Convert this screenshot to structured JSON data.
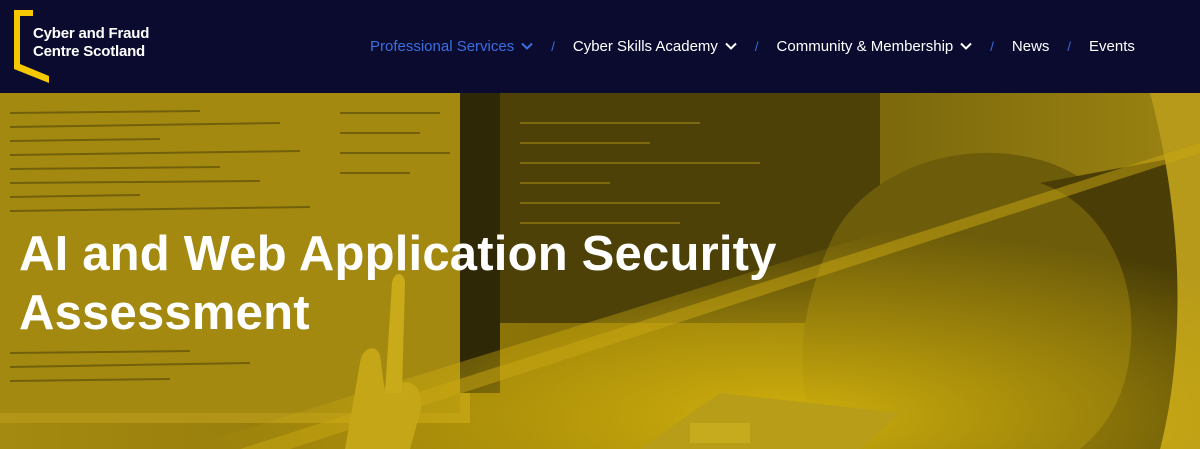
{
  "brand": {
    "line1": "Cyber and Fraud",
    "line2": "Centre Scotland",
    "accent_color": "#f5c800",
    "icon": "bracket-logo-icon"
  },
  "nav": {
    "items": [
      {
        "label": "Professional Services",
        "active": true,
        "has_dropdown": true
      },
      {
        "label": "Cyber Skills Academy",
        "active": false,
        "has_dropdown": true
      },
      {
        "label": "Community & Membership",
        "active": false,
        "has_dropdown": true
      },
      {
        "label": "News",
        "active": false,
        "has_dropdown": false
      },
      {
        "label": "Events",
        "active": false,
        "has_dropdown": false
      }
    ],
    "separator": "/",
    "active_color": "#3b6fe0",
    "background": "#0b0b30"
  },
  "hero": {
    "title_line1": "AI and Web Application Security",
    "title_line2": "Assessment",
    "image": "person-pointing-at-code-monitors-yellow-duotone"
  }
}
